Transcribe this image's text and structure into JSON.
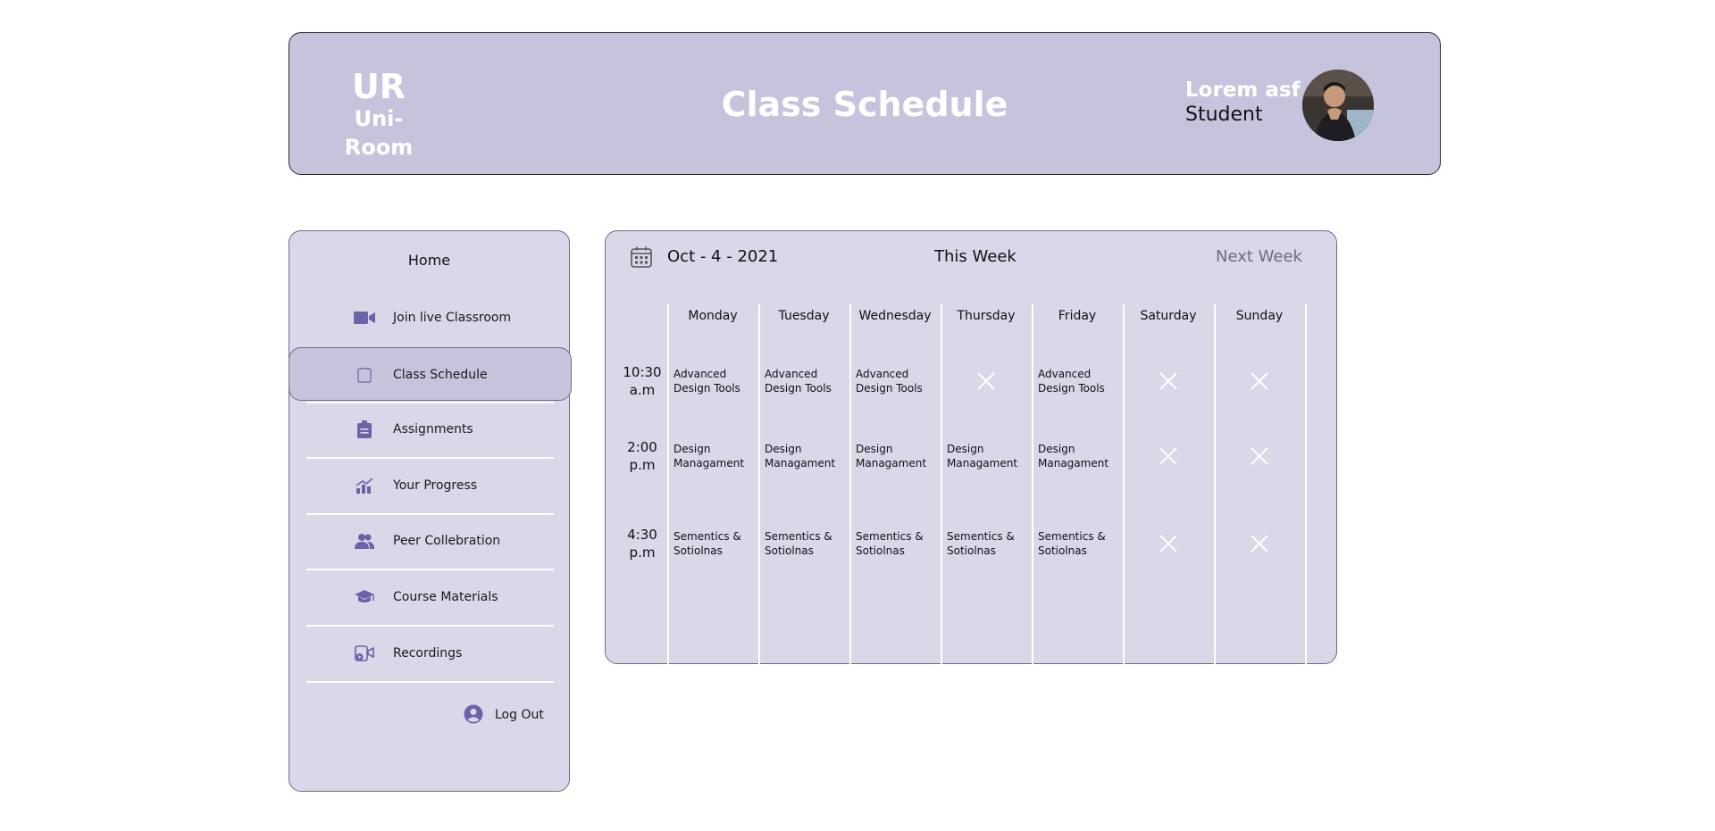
{
  "header": {
    "logo_mark": "UR",
    "logo_text": "Uni-Room",
    "title": "Class Schedule",
    "user_name": "Lorem asf",
    "user_role": "Student"
  },
  "sidebar": {
    "home": "Home",
    "items": [
      {
        "label": "Join live Classroom",
        "icon": "video-camera-icon"
      },
      {
        "label": "Class Schedule",
        "icon": "calendar-icon",
        "active": true
      },
      {
        "label": "Assignments",
        "icon": "clipboard-icon"
      },
      {
        "label": "Your Progress",
        "icon": "chart-icon"
      },
      {
        "label": "Peer Collebration",
        "icon": "people-icon"
      },
      {
        "label": "Course Materials",
        "icon": "graduation-cap-icon"
      },
      {
        "label": "Recordings",
        "icon": "recording-icon"
      }
    ],
    "logout": "Log Out"
  },
  "schedule": {
    "date": "Oct - 4 - 2021",
    "this_week": "This Week",
    "next_week": "Next Week",
    "days": [
      "Monday",
      "Tuesday",
      "Wednesday",
      "Thursday",
      "Friday",
      "Saturday",
      "Sunday"
    ],
    "slots": [
      {
        "time": [
          "10:30",
          "a.m"
        ],
        "classes": [
          "Advanced Design Tools",
          "Advanced Design Tools",
          "Advanced Design Tools",
          null,
          "Advanced Design Tools",
          null,
          null
        ]
      },
      {
        "time": [
          "2:00",
          "p.m"
        ],
        "classes": [
          "Design Managament",
          "Design Managament",
          "Design Managament",
          "Design Managament",
          "Design Managament",
          null,
          null
        ]
      },
      {
        "time": [
          "4:30",
          "p.m"
        ],
        "classes": [
          "Sementics & Sotiolnas",
          "Sementics & Sotiolnas",
          "Sementics & Sotiolnas",
          "Sementics & Sotiolnas",
          "Sementics & Sotiolnas",
          null,
          null
        ]
      }
    ]
  },
  "colors": {
    "header_bg": "#c6c4dd",
    "panel_bg": "#d9d7e8",
    "icon_purple": "#6b63a8"
  }
}
